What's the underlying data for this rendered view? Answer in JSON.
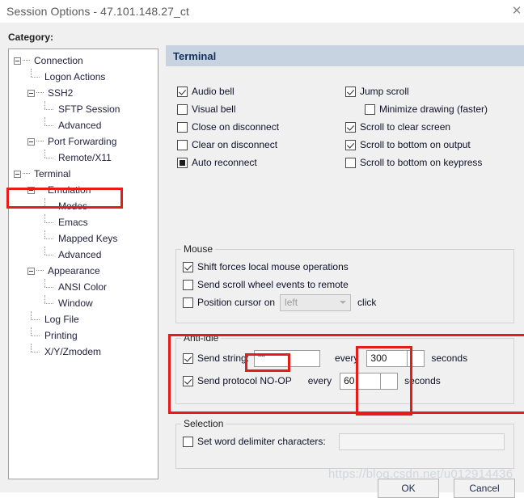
{
  "window": {
    "title": "Session Options - 47.101.148.27_ct",
    "close_icon": "close-icon"
  },
  "category_label": "Category:",
  "tree": {
    "items": [
      {
        "label": "Connection",
        "depth": 0,
        "type": "parent",
        "selected": false
      },
      {
        "label": "Logon Actions",
        "depth": 1,
        "type": "leaf",
        "selected": false
      },
      {
        "label": "SSH2",
        "depth": 1,
        "type": "parent",
        "selected": false
      },
      {
        "label": "SFTP Session",
        "depth": 2,
        "type": "leaf",
        "selected": false
      },
      {
        "label": "Advanced",
        "depth": 2,
        "type": "leaf",
        "selected": false
      },
      {
        "label": "Port Forwarding",
        "depth": 1,
        "type": "parent",
        "selected": false
      },
      {
        "label": "Remote/X11",
        "depth": 2,
        "type": "leaf",
        "selected": false
      },
      {
        "label": "Terminal",
        "depth": 0,
        "type": "parent",
        "selected": true
      },
      {
        "label": "Emulation",
        "depth": 1,
        "type": "parent",
        "selected": false
      },
      {
        "label": "Modes",
        "depth": 2,
        "type": "leaf",
        "selected": false
      },
      {
        "label": "Emacs",
        "depth": 2,
        "type": "leaf",
        "selected": false
      },
      {
        "label": "Mapped Keys",
        "depth": 2,
        "type": "leaf",
        "selected": false
      },
      {
        "label": "Advanced",
        "depth": 2,
        "type": "leaf",
        "selected": false
      },
      {
        "label": "Appearance",
        "depth": 1,
        "type": "parent",
        "selected": false
      },
      {
        "label": "ANSI Color",
        "depth": 2,
        "type": "leaf",
        "selected": false
      },
      {
        "label": "Window",
        "depth": 2,
        "type": "leaf",
        "selected": false
      },
      {
        "label": "Log File",
        "depth": 1,
        "type": "leaf",
        "selected": false
      },
      {
        "label": "Printing",
        "depth": 1,
        "type": "leaf",
        "selected": false
      },
      {
        "label": "X/Y/Zmodem",
        "depth": 1,
        "type": "leaf",
        "selected": false
      }
    ]
  },
  "panel": {
    "header": "Terminal",
    "options_left": [
      {
        "label": "Audio bell",
        "state": "checked"
      },
      {
        "label": "Visual bell",
        "state": "unchecked"
      },
      {
        "label": "Close on disconnect",
        "state": "unchecked"
      },
      {
        "label": "Clear on disconnect",
        "state": "unchecked"
      },
      {
        "label": "Auto reconnect",
        "state": "filled"
      }
    ],
    "options_right": [
      {
        "label": "Jump scroll",
        "state": "checked",
        "indent": false
      },
      {
        "label": "Minimize drawing (faster)",
        "state": "unchecked",
        "indent": true
      },
      {
        "label": "Scroll to clear screen",
        "state": "checked",
        "indent": false
      },
      {
        "label": "Scroll to bottom on output",
        "state": "checked",
        "indent": false
      },
      {
        "label": "Scroll to bottom on keypress",
        "state": "unchecked",
        "indent": false
      }
    ],
    "mouse": {
      "title": "Mouse",
      "shift_forces": {
        "label": "Shift forces local mouse operations",
        "state": "checked"
      },
      "send_scroll": {
        "label": "Send scroll wheel events to remote",
        "state": "unchecked"
      },
      "position_cursor": {
        "label": "Position cursor on",
        "state": "unchecked",
        "select_value": "left",
        "suffix": "click"
      }
    },
    "antiidle": {
      "title": "Anti-idle",
      "send_string": {
        "label": "Send string:",
        "state": "checked",
        "value": "\"\"",
        "every": "every",
        "seconds_value": "300",
        "seconds_label": "seconds"
      },
      "send_noop": {
        "label": "Send protocol NO-OP",
        "state": "checked",
        "every": "every",
        "seconds_value": "60",
        "seconds_label": "seconds"
      }
    },
    "selection": {
      "title": "Selection",
      "word_delim": {
        "label": "Set word delimiter characters:",
        "state": "unchecked",
        "value": ""
      }
    }
  },
  "watermark": "https://blog.csdn.net/u012914436",
  "buttons": {
    "ok": "OK",
    "cancel": "Cancel"
  },
  "colors": {
    "header_band": "#c7d3e0",
    "annotation_red": "#e51d18",
    "dialog_bg": "#f0f0f0"
  }
}
